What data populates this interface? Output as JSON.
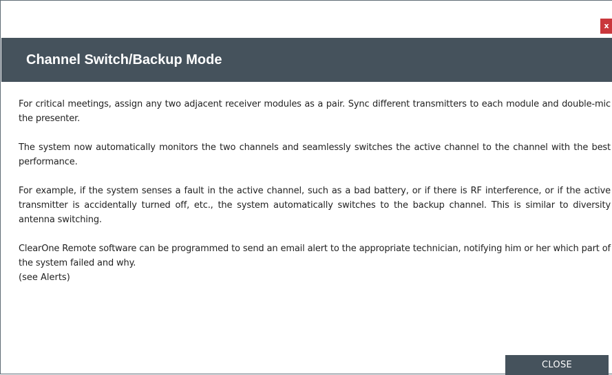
{
  "dialog": {
    "close_x_label": "x",
    "title": "Channel Switch/Backup Mode",
    "paragraphs": [
      "For critical meetings, assign any two adjacent receiver modules as a pair. Sync different transmitters to each module and double-mic the presenter.",
      "The system now automatically monitors the two channels and seamlessly switches the active channel to the channel with the best performance.",
      "For example, if the system senses a fault in the active channel, such as a bad battery, or if there is RF interference, or if the active transmitter is accidentally turned off, etc., the system automatically switches to the backup channel.  This is similar to diversity antenna switching.",
      "ClearOne Remote software can be programmed to send an email alert to the appropriate technician, notifying him or her which part of the system failed and why."
    ],
    "see_alerts": "(see Alerts)",
    "close_button_label": "CLOSE",
    "colors": {
      "header_bg": "#45525c",
      "close_x_bg": "#c9373c",
      "button_bg": "#45525c",
      "text": "#222222"
    }
  }
}
